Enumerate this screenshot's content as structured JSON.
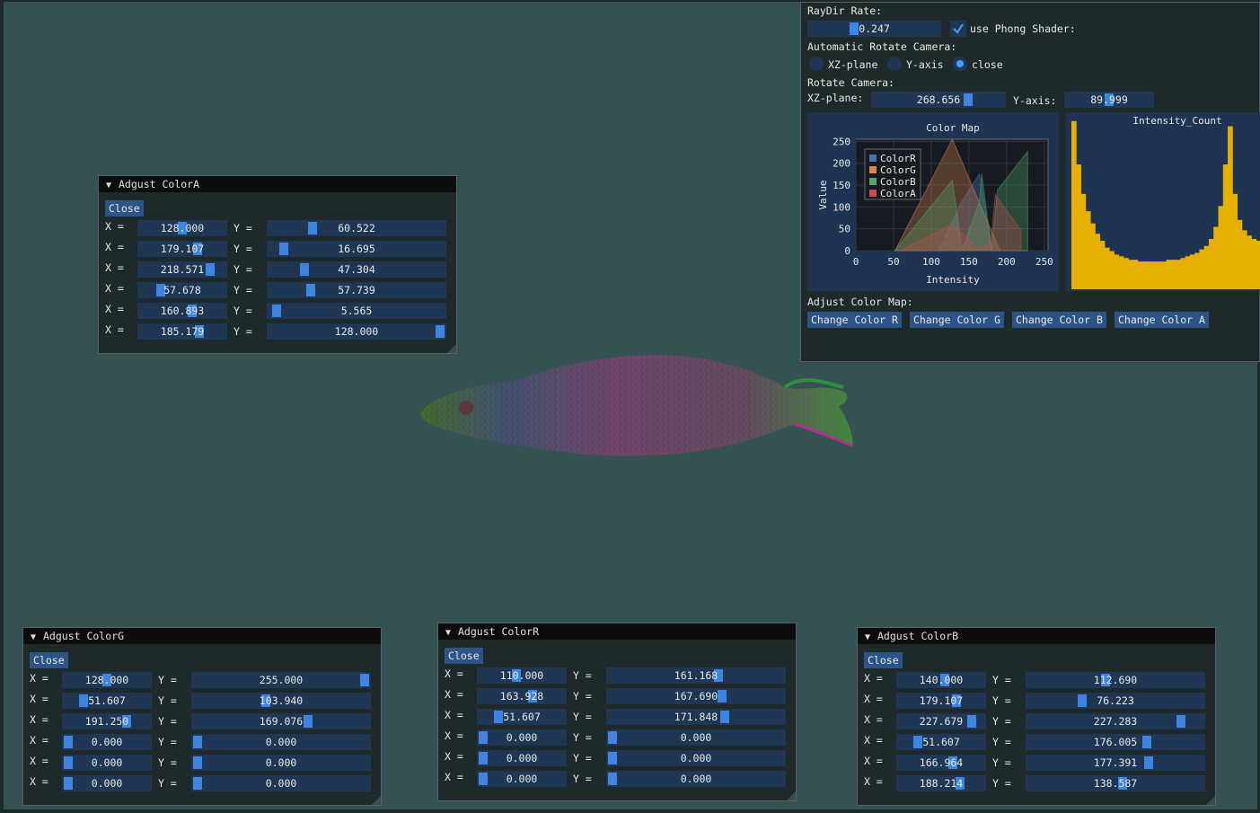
{
  "main_panel": {
    "raydir_label": "RayDir Rate:",
    "raydir_value": "0.247",
    "phong_label": "use Phong Shader:",
    "phong_checked": true,
    "auto_rotate_label": "Automatic Rotate Camera:",
    "radios": [
      {
        "label": "XZ-plane",
        "selected": false
      },
      {
        "label": "Y-axis",
        "selected": false
      },
      {
        "label": "close",
        "selected": true
      }
    ],
    "rotate_label": "Rotate Camera:",
    "xz_label": "XZ-plane:",
    "xz_value": "268.656",
    "y_label": "Y-axis:",
    "y_value": "89.999",
    "adjust_label": "Adjust Color Map:",
    "buttons": [
      "Change Color R",
      "Change Color G",
      "Change Color B",
      "Change Color A"
    ]
  },
  "chart_data": [
    {
      "type": "area",
      "title": "Color Map",
      "xlabel": "Intensity",
      "ylabel": "Value",
      "xlim": [
        0,
        255
      ],
      "ylim": [
        0,
        255
      ],
      "xticks": [
        "0",
        "50",
        "100",
        "150",
        "200",
        "250"
      ],
      "yticks": [
        "0",
        "50",
        "100",
        "150",
        "200",
        "250"
      ],
      "legend_position": "top-left",
      "series": [
        {
          "name": "ColorR",
          "color": "#4c72b0",
          "x": [
            110,
            141,
            164,
            180,
            228
          ],
          "y": [
            0,
            113,
            176,
            0,
            0
          ]
        },
        {
          "name": "ColorG",
          "color": "#dd8452",
          "x": [
            52,
            128,
            191
          ],
          "y": [
            0,
            255,
            0
          ]
        },
        {
          "name": "ColorB",
          "color": "#55a868",
          "x": [
            52,
            128,
            141,
            164,
            167,
            180,
            188,
            228
          ],
          "y": [
            0,
            161,
            0,
            113,
            177,
            0,
            139,
            227
          ]
        },
        {
          "name": "ColorA",
          "color": "#c44e52",
          "x": [
            58,
            128,
            161,
            179,
            185,
            219
          ],
          "y": [
            0,
            61,
            6,
            17,
            128,
            47
          ]
        }
      ]
    },
    {
      "type": "bar",
      "title": "Intensity_Count",
      "color": "#e6b000",
      "values": [
        0.97,
        0.72,
        0.55,
        0.45,
        0.38,
        0.32,
        0.28,
        0.24,
        0.22,
        0.2,
        0.19,
        0.18,
        0.17,
        0.17,
        0.16,
        0.16,
        0.16,
        0.16,
        0.16,
        0.16,
        0.17,
        0.17,
        0.17,
        0.18,
        0.19,
        0.2,
        0.21,
        0.23,
        0.25,
        0.29,
        0.36,
        0.48,
        0.72,
        0.94,
        0.55,
        0.4,
        0.34,
        0.31,
        0.29,
        0.28
      ]
    }
  ],
  "windows": [
    {
      "title": "Adgust ColorA",
      "close": "Close",
      "rows": [
        {
          "x": "128.000",
          "y": "60.522",
          "xf": 0.502,
          "yf": 0.237
        },
        {
          "x": "179.107",
          "y": "16.695",
          "xf": 0.702,
          "yf": 0.065
        },
        {
          "x": "218.571",
          "y": "47.304",
          "xf": 0.857,
          "yf": 0.186
        },
        {
          "x": "57.678",
          "y": "57.739",
          "xf": 0.226,
          "yf": 0.226
        },
        {
          "x": "160.893",
          "y": "5.565",
          "xf": 0.631,
          "yf": 0.022
        },
        {
          "x": "185.179",
          "y": "128.000",
          "xf": 0.726,
          "yf": 1.0
        }
      ]
    },
    {
      "title": "Adgust ColorG",
      "close": "Close",
      "rows": [
        {
          "x": "128.000",
          "y": "255.000",
          "xf": 0.502,
          "yf": 1.0
        },
        {
          "x": "51.607",
          "y": "103.940",
          "xf": 0.202,
          "yf": 0.408
        },
        {
          "x": "191.250",
          "y": "169.076",
          "xf": 0.75,
          "yf": 0.663
        },
        {
          "x": "0.000",
          "y": "0.000",
          "xf": 0.0,
          "yf": 0.0
        },
        {
          "x": "0.000",
          "y": "0.000",
          "xf": 0.0,
          "yf": 0.0
        },
        {
          "x": "0.000",
          "y": "0.000",
          "xf": 0.0,
          "yf": 0.0
        }
      ]
    },
    {
      "title": "Adgust ColorR",
      "close": "Close",
      "rows": [
        {
          "x": "110.000",
          "y": "161.168",
          "xf": 0.431,
          "yf": 0.632
        },
        {
          "x": "163.928",
          "y": "167.690",
          "xf": 0.643,
          "yf": 0.658
        },
        {
          "x": "51.607",
          "y": "171.848",
          "xf": 0.202,
          "yf": 0.674
        },
        {
          "x": "0.000",
          "y": "0.000",
          "xf": 0.0,
          "yf": 0.0
        },
        {
          "x": "0.000",
          "y": "0.000",
          "xf": 0.0,
          "yf": 0.0
        },
        {
          "x": "0.000",
          "y": "0.000",
          "xf": 0.0,
          "yf": 0.0
        }
      ]
    },
    {
      "title": "Adgust ColorB",
      "close": "Close",
      "rows": [
        {
          "x": "140.000",
          "y": "112.690",
          "xf": 0.549,
          "yf": 0.442
        },
        {
          "x": "179.107",
          "y": "76.223",
          "xf": 0.702,
          "yf": 0.299
        },
        {
          "x": "227.679",
          "y": "227.283",
          "xf": 0.893,
          "yf": 0.891
        },
        {
          "x": "51.607",
          "y": "176.005",
          "xf": 0.202,
          "yf": 0.69
        },
        {
          "x": "166.964",
          "y": "177.391",
          "xf": 0.655,
          "yf": 0.696
        },
        {
          "x": "188.214",
          "y": "138.587",
          "xf": 0.738,
          "yf": 0.543
        }
      ]
    }
  ],
  "labels": {
    "x_eq": "X =",
    "y_eq": "Y ="
  },
  "sliders": {
    "raydir_fraction": 0.33,
    "xz_fraction": 0.746,
    "y_fraction": 0.5
  }
}
